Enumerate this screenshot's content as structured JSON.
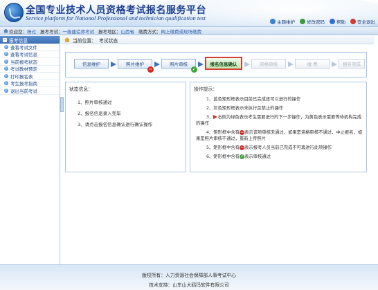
{
  "header": {
    "title": "全国专业技术人员资格考试报名服务平台",
    "subtitle": "Service platform for National Professional and technician qualification test",
    "links": [
      "主题维护",
      "修改密码",
      "帮助",
      "安全退出"
    ]
  },
  "infobar": {
    "welcome_label": "欢迎您：",
    "welcome_value": "杨过",
    "exam_label": "报考考试：",
    "exam_value": "一级建造师考试",
    "area_label": "报考地区：",
    "area_value": "山西省",
    "fee_label": "缴费方式：",
    "fee_value": "网上缴费或现场缴费"
  },
  "sidebar": {
    "heading": "报考信息",
    "items": [
      {
        "label": "查看考试文件"
      },
      {
        "label": "查看考试信息"
      },
      {
        "label": "当前报考状态"
      },
      {
        "label": "考试教材预定"
      },
      {
        "label": "打印报名表"
      },
      {
        "label": "考生报考指南"
      },
      {
        "label": "退出当前考试"
      }
    ]
  },
  "breadcrumb": {
    "label": "当前位置：",
    "value": "考试状态"
  },
  "steps": [
    {
      "label": "信息维护",
      "state": "done"
    },
    {
      "label": "照片维护",
      "state": "error"
    },
    {
      "label": "照片审核",
      "state": "ok"
    },
    {
      "label": "报名信息确认",
      "state": "current"
    },
    {
      "label": "资格审核",
      "state": "pending"
    },
    {
      "label": "缴 费",
      "state": "pending"
    },
    {
      "label": "报名完成",
      "state": "pending"
    }
  ],
  "status_panel": {
    "title": "状态信息：",
    "lines": [
      "1、照片审核通过",
      "2、报名信息录入完毕",
      "3、请点击报名信息确认进行确认操作"
    ]
  },
  "tips_panel": {
    "title": "操作提示：",
    "tip1": "1、蓝色矩形框表示目前已完成还可以进行的操作",
    "tip2": "2、灰色矩形框表示未执行且禁止的操作",
    "tip3_a": "3、",
    "tip3_b": "右侧为绿色表示考生需要进行的下一步操作，为黄色表示需要等待机构完成",
    "tip3_c": "的操作",
    "tip4_a": "4、矩形框中含有",
    "tip4_b": "表示该项审核未通过，如果是资格审核不通过，中止报名，如",
    "tip4_c": "果是照片审核不通过，重新上传照片",
    "tip5_a": "5、矩形框中含有",
    "tip5_b": "表示报考人员当前已完成不可再进行此项操作",
    "tip6_a": "6、矩形框中含有",
    "tip6_b": "表示审核通过"
  },
  "footer": {
    "copyright": "版权所有：人力资源社会保障部人事考试中心",
    "support": "技术支持：山东山大鸥玛软件有限公司"
  }
}
